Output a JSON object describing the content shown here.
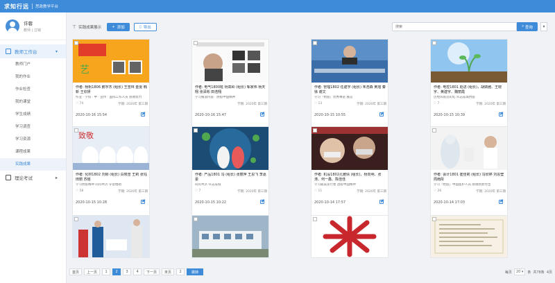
{
  "header": {
    "logo": "求知行远",
    "subtitle": "思政教学平台"
  },
  "user": {
    "name": "许蓉",
    "role": "教师 | 注销"
  },
  "sidebar": {
    "group1": "教师工作台",
    "items": [
      "教师门户",
      "我的作业",
      "作业检查",
      "我的课堂",
      "学生成绩",
      "学习调查",
      "学习资源",
      "课程成果",
      "实践成果"
    ],
    "group2": "理论考试"
  },
  "toolbar": {
    "label": "实践成果展示",
    "add": "添加",
    "export": "导出",
    "search_placeholder": "搜索",
    "search_btn": "查询",
    "more": "▾"
  },
  "cards": [
    {
      "title": "作者: 杨帆1806 鹏宇杰 (组长) 王雪林 金雯 韩新 王欣妍",
      "desc": "作业 · 学院 · 中 · 宣传 · 国际工作人员 感谢努力",
      "likes": "74",
      "term": "学期: 2020年 第三期",
      "date": "2020-10-16 15:54"
    },
    {
      "title": "作者: 电气1800班 杨高岭 (组长) 邹家伟 杨天翔 张泽彬 田浩翔",
      "desc": "学习报道内容 · 防疫中国精神",
      "likes": "",
      "term": "学期: 2020年 第三期",
      "date": "2020-10-16 15:47"
    },
    {
      "title": "作者: 管理1802 任建宇 (组长) 朱浩森 黄旭 秦 徐 谢文",
      "desc": "学习「抗疫」优秀事迹 展览",
      "likes": "13",
      "term": "学期: 2020年 第三期",
      "date": "2020-10-15 10:55"
    },
    {
      "title": "作者: 电控1801 赵进 (组长)，胡婧雅、王晓宇、黄建宇、魏丽霞",
      "desc": "历经风雨见彩虹 众志成城抗疫",
      "likes": "7",
      "term": "学期: 2020年 第三期",
      "date": "2020-10-15 10:39"
    },
    {
      "title": "作者: 化材1802 刘颖 (组长) 白晓雪 王莉 张钰 田丽 苏瑶",
      "desc": "学习抗疫精神 同舟共济 守望相助",
      "likes": "58",
      "term": "学期: 2020年 第三期",
      "date": "2020-10-15 10:28"
    },
    {
      "title": "作者: 产品1801 冯 (组长) 张丽萍 王思飞 李嘉豪",
      "desc": "同舟共济 众志成城",
      "likes": "7",
      "term": "学期: 2020年 第三期",
      "date": "2020-10-15 10:22"
    },
    {
      "title": "作者: 机设1802孔雅倩 (组长)，杨向明、张涛、何一鑫、陈佳佳",
      "desc": "学习最美逆行者 战疫中国精神",
      "likes": "11",
      "term": "学期: 2020年 第三期",
      "date": "2020-10-14 17:57"
    },
    {
      "title": "作者: 会计1801 崔佳莉 (组长) 冯欣婷 刘思莹 周雨彤",
      "desc": "学习「抗疫」中国医护人员 感谢默默付出",
      "likes": "26",
      "term": "学期: 2020年 第三期",
      "date": "2020-10-14 17:03"
    }
  ],
  "pager": {
    "first": "首页",
    "prev": "上一页",
    "pages": [
      "1",
      "2",
      "3",
      "4"
    ],
    "next": "下一页",
    "last": "末页",
    "jump": "2",
    "go": "跳转",
    "size_label": "每页",
    "size": "20",
    "unit": "条",
    "total": "共78条",
    "pages_count": "4页"
  },
  "colors": {
    "accent": "#3d8bd9",
    "bg": "#f0f2f5"
  }
}
